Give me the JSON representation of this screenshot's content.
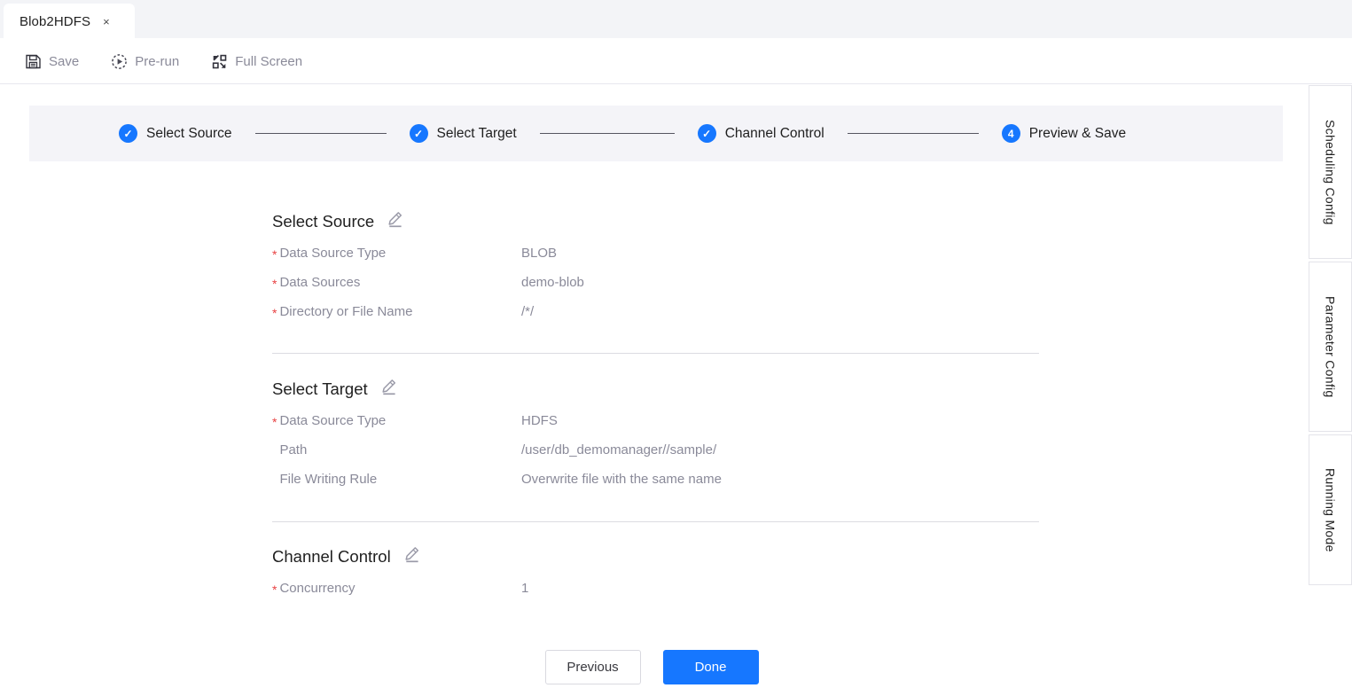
{
  "tab": {
    "label": "Blob2HDFS",
    "close_glyph": "×"
  },
  "toolbar": {
    "items": [
      {
        "label": "Save",
        "icon": "save-floppy-icon"
      },
      {
        "label": "Pre-run",
        "icon": "play-circle-dashed-icon"
      },
      {
        "label": "Full Screen",
        "icon": "fullscreen-expand-icon"
      }
    ]
  },
  "stepper": {
    "steps": [
      {
        "label": "Select Source",
        "badge": "✓",
        "state": "done"
      },
      {
        "label": "Select Target",
        "badge": "✓",
        "state": "done"
      },
      {
        "label": "Channel Control",
        "badge": "✓",
        "state": "done"
      },
      {
        "label": "Preview & Save",
        "badge": "4",
        "state": "current"
      }
    ]
  },
  "sections": [
    {
      "title": "Select Source",
      "edit_icon": "pencil-edit-icon",
      "rows": [
        {
          "label": "Data Source Type",
          "required": true,
          "value": "BLOB"
        },
        {
          "label": "Data Sources",
          "required": true,
          "value": "demo-blob"
        },
        {
          "label": "Directory or File Name",
          "required": true,
          "value": "/*/"
        }
      ]
    },
    {
      "title": "Select Target",
      "edit_icon": "pencil-edit-icon",
      "rows": [
        {
          "label": "Data Source Type",
          "required": true,
          "value": "HDFS"
        },
        {
          "label": "Path",
          "required": false,
          "value": "/user/db_demomanager//sample/"
        },
        {
          "label": "File Writing Rule",
          "required": false,
          "value": "Overwrite file with the same name"
        }
      ]
    },
    {
      "title": "Channel Control",
      "edit_icon": "pencil-edit-icon",
      "rows": [
        {
          "label": "Concurrency",
          "required": true,
          "value": "1"
        }
      ]
    }
  ],
  "footer": {
    "previous_label": "Previous",
    "done_label": "Done"
  },
  "side_panel": {
    "tabs": [
      {
        "label": "Scheduling Config"
      },
      {
        "label": "Parameter Config"
      },
      {
        "label": "Running Mode"
      }
    ]
  },
  "colors": {
    "accent": "#1677ff",
    "required_star": "#e84142",
    "band_bg": "#f4f4f8",
    "muted_text": "#8a8a99"
  }
}
